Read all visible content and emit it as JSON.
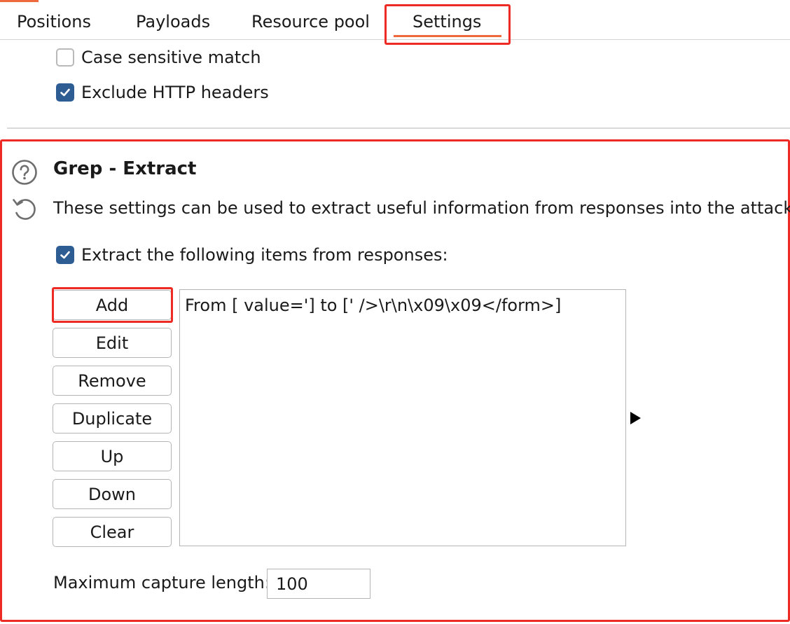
{
  "tabs": [
    {
      "label": "Positions"
    },
    {
      "label": "Payloads"
    },
    {
      "label": "Resource pool"
    },
    {
      "label": "Settings",
      "active": true
    }
  ],
  "match_options": {
    "case_sensitive": {
      "label": "Case sensitive match",
      "checked": false
    },
    "exclude_headers": {
      "label": "Exclude HTTP headers",
      "checked": true
    }
  },
  "grep_extract": {
    "title": "Grep - Extract",
    "description": "These settings can be used to extract useful information from responses into the attack res",
    "extract_checkbox": {
      "label": "Extract the following items from responses:",
      "checked": true
    },
    "buttons": {
      "add": "Add",
      "edit": "Edit",
      "remove": "Remove",
      "duplicate": "Duplicate",
      "up": "Up",
      "down": "Down",
      "clear": "Clear"
    },
    "items": [
      "From [ value='] to [' />\\r\\n\\x09\\x09</form>]"
    ],
    "max_capture_label": "Maximum capture length:",
    "max_capture_value": "100"
  },
  "icons": {
    "help": "help-circle-icon",
    "restore": "restore-defaults-icon",
    "check": "checkmark-icon",
    "expand": "triangle-right-icon"
  },
  "colors": {
    "accent": "#ee6a3c",
    "highlight_box": "#ee2a24",
    "checkbox_checked": "#2e5d93"
  }
}
